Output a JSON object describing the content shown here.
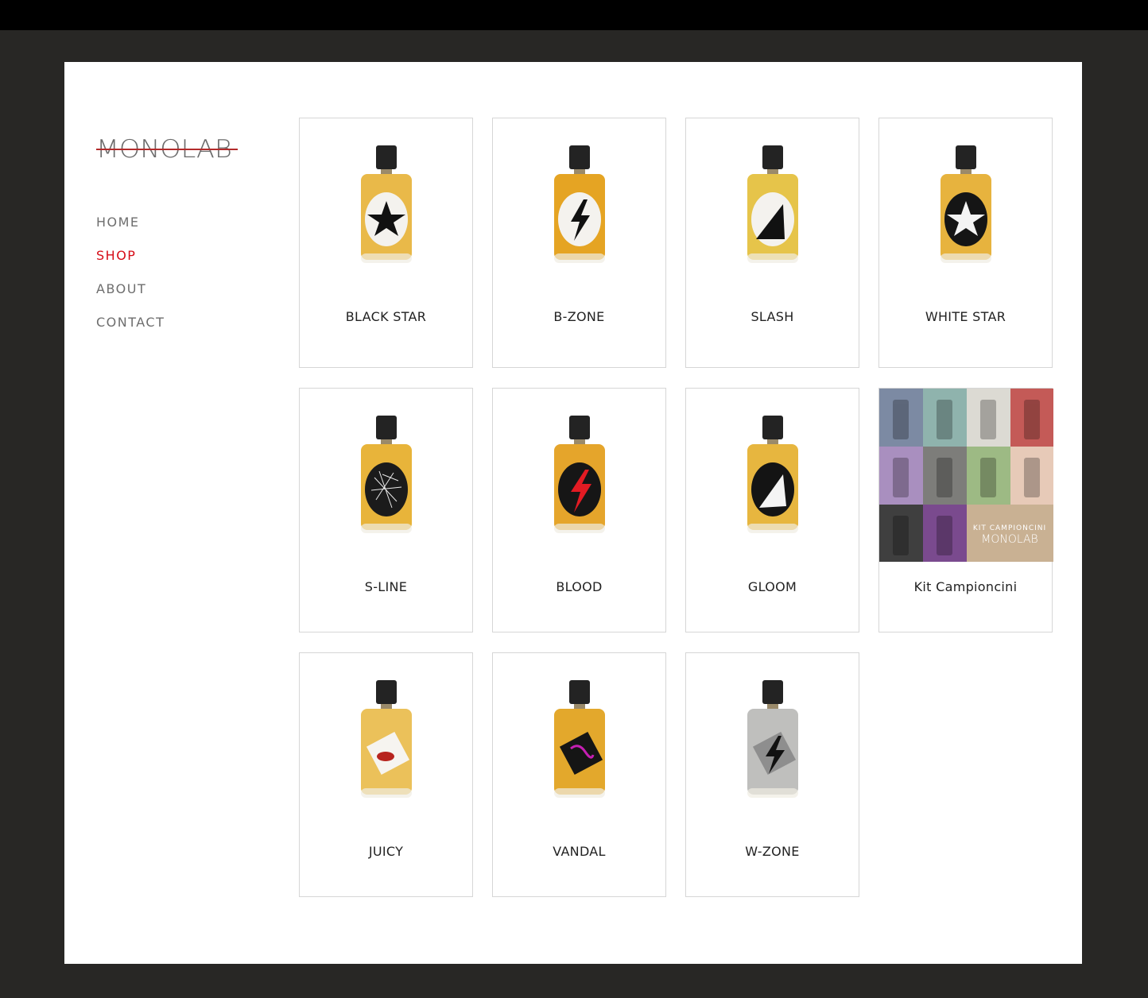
{
  "brand": {
    "logo_text": "MONOLAB"
  },
  "nav": {
    "items": [
      {
        "label": "HOME",
        "active": false
      },
      {
        "label": "SHOP",
        "active": true
      },
      {
        "label": "ABOUT",
        "active": false
      },
      {
        "label": "CONTACT",
        "active": false
      }
    ]
  },
  "colors": {
    "accent": "#d60c17",
    "frame": "#282725",
    "bottle_liquid": "#e9b949",
    "cap": "#222222"
  },
  "products": [
    {
      "name": "BLACK STAR",
      "label_text": "BLACK STAR",
      "icon": "black-star-icon"
    },
    {
      "name": "B-ZONE",
      "label_text": "B-ZONE",
      "icon": "lightning-icon"
    },
    {
      "name": "SLASH",
      "label_text": "SLASH",
      "icon": "slash-icon"
    },
    {
      "name": "WHITE STAR",
      "label_text": "WHITE STAR",
      "icon": "white-star-icon"
    },
    {
      "name": "S-LINE",
      "label_text": "S-LINE",
      "icon": "splatter-icon"
    },
    {
      "name": "BLOOD",
      "label_text": "BLOOD",
      "icon": "red-lightning-icon"
    },
    {
      "name": "GLOOM",
      "label_text": "GLOOM",
      "icon": "gloom-icon"
    },
    {
      "name": "Kit Campioncini",
      "label_text": "KIT CAMPIONCINI",
      "icon": "sample-kit-image"
    },
    {
      "name": "JUICY",
      "label_text": "JUICY",
      "icon": "lips-icon"
    },
    {
      "name": "VANDAL",
      "label_text": "VANDAL",
      "icon": "graffiti-icon"
    },
    {
      "name": "W-ZONE",
      "label_text": "W-ZONE",
      "icon": "grey-lightning-icon"
    }
  ],
  "kit": {
    "banner_line1": "KIT CAMPIONCINI",
    "banner_line2": "MONOLAB"
  }
}
